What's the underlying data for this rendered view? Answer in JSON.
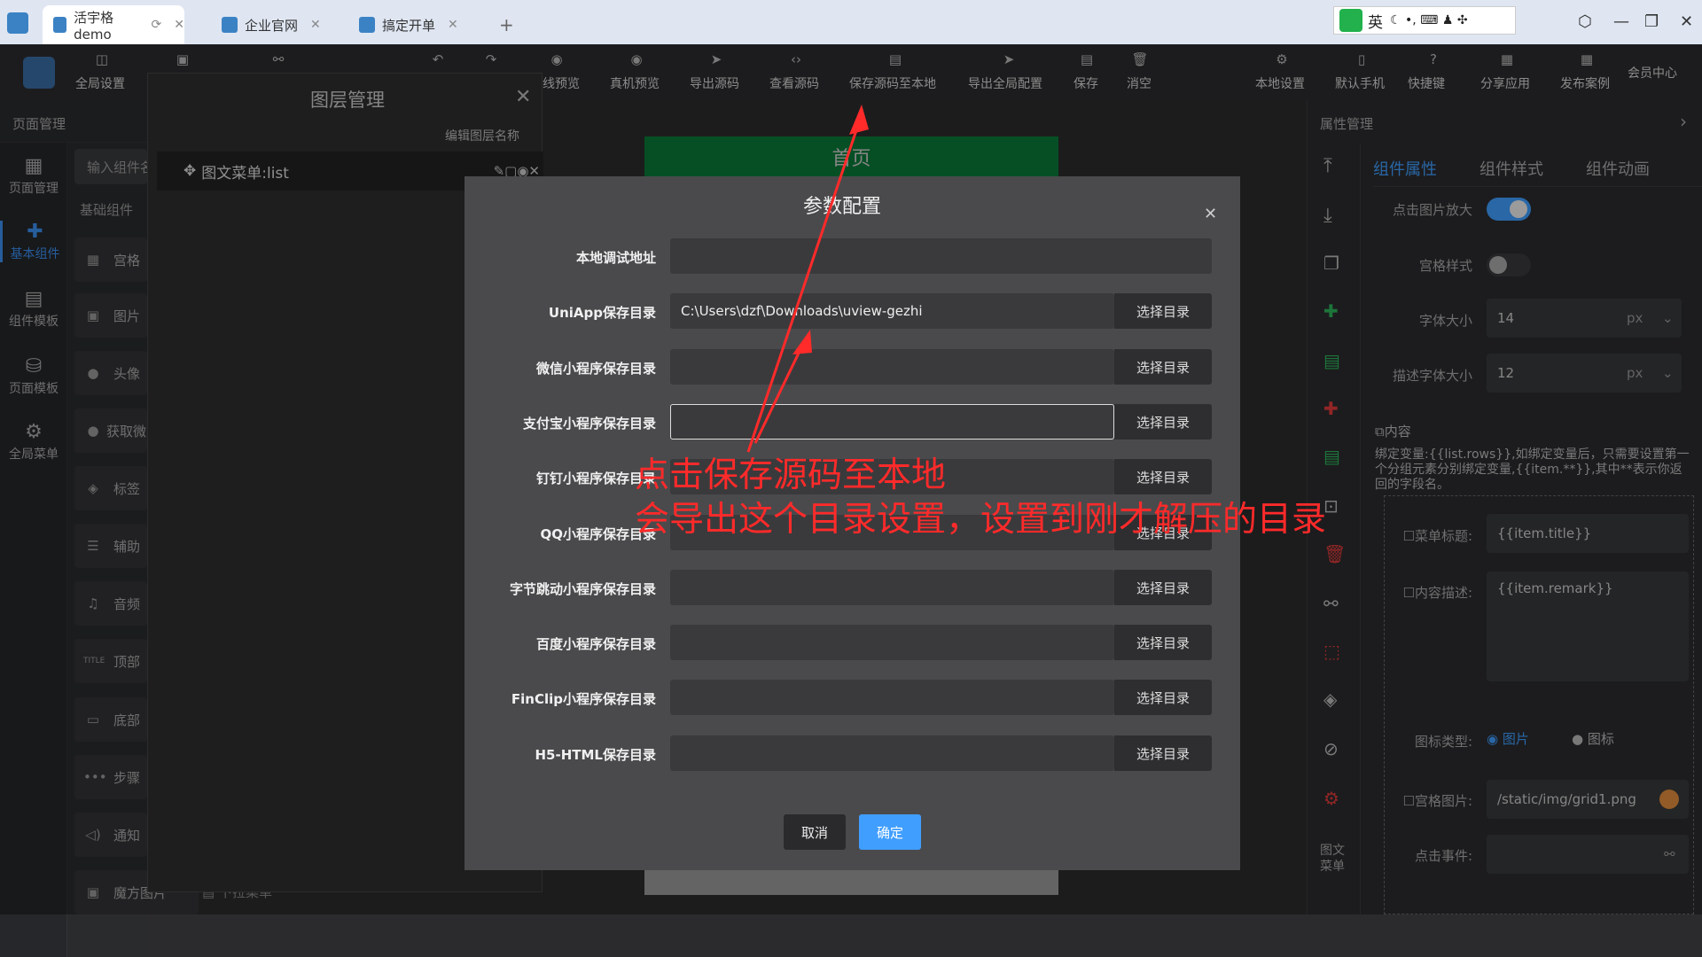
{
  "browser": {
    "tabs": [
      {
        "label": "活宇格demo",
        "active": true
      },
      {
        "label": "企业官网",
        "active": false
      },
      {
        "label": "搞定开单",
        "active": false
      }
    ],
    "new_tab": "+",
    "ime": "英"
  },
  "toolbar": {
    "global_settings": "全局设置",
    "web_preview": "线预览",
    "device_preview": "真机预览",
    "export_source": "导出源码",
    "view_source": "查看源码",
    "save_source_local": "保存源码至本地",
    "export_global_config": "导出全局配置",
    "save": "保存",
    "clear": "消空",
    "local_settings": "本地设置",
    "default_phone": "默认手机",
    "shortcuts": "快捷键",
    "share_app": "分享应用",
    "publish_case": "发布案例",
    "member_center": "会员中心"
  },
  "page_mgmt_label": "页面管理",
  "rail": [
    {
      "label": "页面管理",
      "icon": "grid-icon"
    },
    {
      "label": "基本组件",
      "icon": "puzzle-icon",
      "active": true
    },
    {
      "label": "组件模板",
      "icon": "template-icon"
    },
    {
      "label": "页面模板",
      "icon": "database-icon"
    },
    {
      "label": "全局菜单",
      "icon": "gear-icon"
    }
  ],
  "components": {
    "search_placeholder": "输入组件名",
    "section": "基础组件",
    "items": [
      "宫格",
      "图片",
      "头像",
      "获取微",
      "标签",
      "辅助",
      "音频",
      "顶部",
      "底部",
      "步骤",
      "通知",
      "魔方图片"
    ],
    "bottom_extra": "下拉菜单"
  },
  "layer_panel": {
    "title": "图层管理",
    "edit_name": "编辑图层名称",
    "item": "图文菜单:list"
  },
  "canvas": {
    "header": "首页"
  },
  "modal": {
    "title": "参数配置",
    "rows": [
      {
        "label": "本地调试地址",
        "value": "",
        "has_button": false
      },
      {
        "label": "UniApp保存目录",
        "value": "C:\\Users\\dzf\\Downloads\\uview-gezhi",
        "has_button": true
      },
      {
        "label": "微信小程序保存目录",
        "value": "",
        "has_button": true
      },
      {
        "label": "支付宝小程序保存目录",
        "value": "",
        "has_button": true,
        "focused": true
      },
      {
        "label": "钉钉小程序保存目录",
        "value": "",
        "has_button": true
      },
      {
        "label": "QQ小程序保存目录",
        "value": "",
        "has_button": true
      },
      {
        "label": "字节跳动小程序保存目录",
        "value": "",
        "has_button": true
      },
      {
        "label": "百度小程序保存目录",
        "value": "",
        "has_button": true
      },
      {
        "label": "FinClip小程序保存目录",
        "value": "",
        "has_button": true
      },
      {
        "label": "H5-HTML保存目录",
        "value": "",
        "has_button": true
      }
    ],
    "choose_dir": "选择目录",
    "cancel": "取消",
    "confirm": "确定"
  },
  "annotation": {
    "line1": "点击保存源码至本地",
    "line2": "会导出这个目录设置，设置到刚才解压的目录",
    "color": "#ff2a2a"
  },
  "right_panel": {
    "title": "属性管理",
    "tabs": [
      "组件属性",
      "组件样式",
      "组件动画"
    ],
    "click_zoom_label": "点击图片放大",
    "click_zoom_on": true,
    "grid_style_label": "宫格样式",
    "grid_style_on": false,
    "font_size_label": "字体大小",
    "font_size": "14",
    "desc_font_size_label": "描述字体大小",
    "desc_font_size": "12",
    "unit": "px",
    "content_label": "内容",
    "bind_hint": "绑定变量:{{list.rows}},如绑定变量后，只需要设置第一个分组元素分别绑定变量,{{item.**}},其中**表示你返回的字段名。",
    "menu_title_label": "菜单标题:",
    "menu_title": "{{item.title}}",
    "content_desc_label": "内容描述:",
    "content_desc": "{{item.remark}}",
    "icon_type_label": "图标类型:",
    "icon_type_options": [
      "图片",
      "图标"
    ],
    "icon_type_selected": "图片",
    "grid_image_label": "宫格图片:",
    "grid_image": "/static/img/grid1.png",
    "click_event_label": "点击事件:",
    "side_label": "图文菜单"
  },
  "accent_color": "#409eff"
}
